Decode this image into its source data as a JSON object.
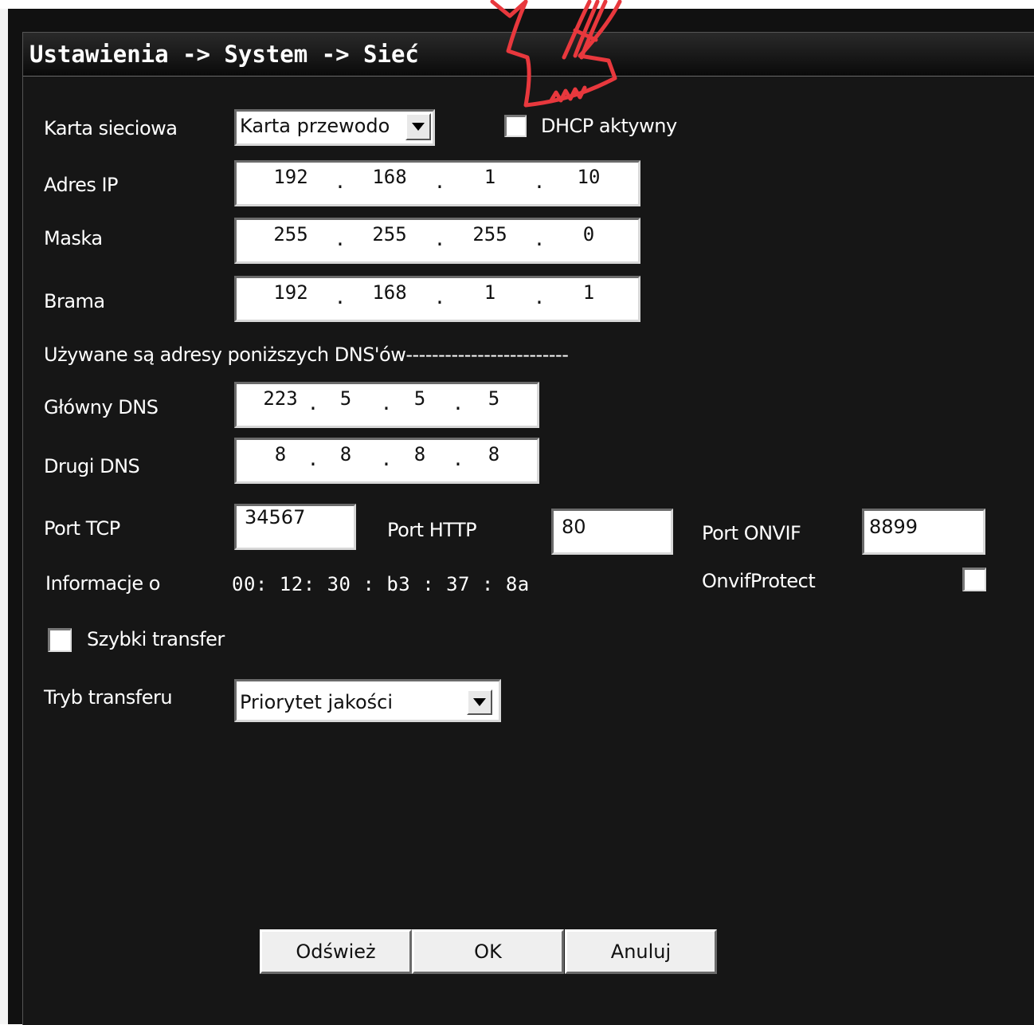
{
  "title": "Ustawienia -> System -> Sieć",
  "network_card": {
    "label": "Karta sieciowa",
    "value": "Karta przewodo"
  },
  "dhcp": {
    "label": "DHCP aktywny",
    "checked": false
  },
  "ip_address": {
    "label": "Adres IP",
    "octets": [
      "192",
      "168",
      "1",
      "10"
    ]
  },
  "mask": {
    "label": "Maska",
    "octets": [
      "255",
      "255",
      "255",
      "0"
    ]
  },
  "gateway": {
    "label": "Brama",
    "octets": [
      "192",
      "168",
      "1",
      "1"
    ]
  },
  "dns_heading": "Używane są adresy poniższych DNS'ów-------------------------",
  "primary_dns": {
    "label": "Główny DNS",
    "octets": [
      "223",
      "5",
      "5",
      "5"
    ]
  },
  "secondary_dns": {
    "label": "Drugi DNS",
    "octets": [
      "8",
      "8",
      "8",
      "8"
    ]
  },
  "tcp_port": {
    "label": "Port TCP",
    "value": "34567"
  },
  "http_port": {
    "label": "Port HTTP",
    "value": "80"
  },
  "onvif_port": {
    "label": "Port ONVIF",
    "value": "8899"
  },
  "mac_info": {
    "label": "Informacje o",
    "value": "00: 12: 30 : b3 : 37 : 8a"
  },
  "onvif_protect": {
    "label": "OnvifProtect",
    "checked": false
  },
  "fast_transfer": {
    "label": "Szybki transfer",
    "checked": false
  },
  "transfer_mode": {
    "label": "Tryb transferu",
    "value": "Priorytet jakości"
  },
  "buttons": {
    "refresh": "Odśwież",
    "ok": "OK",
    "cancel": "Anuluj"
  },
  "colors": {
    "background": "#161616",
    "annotation": "#e8383d",
    "text": "#ffffff"
  }
}
